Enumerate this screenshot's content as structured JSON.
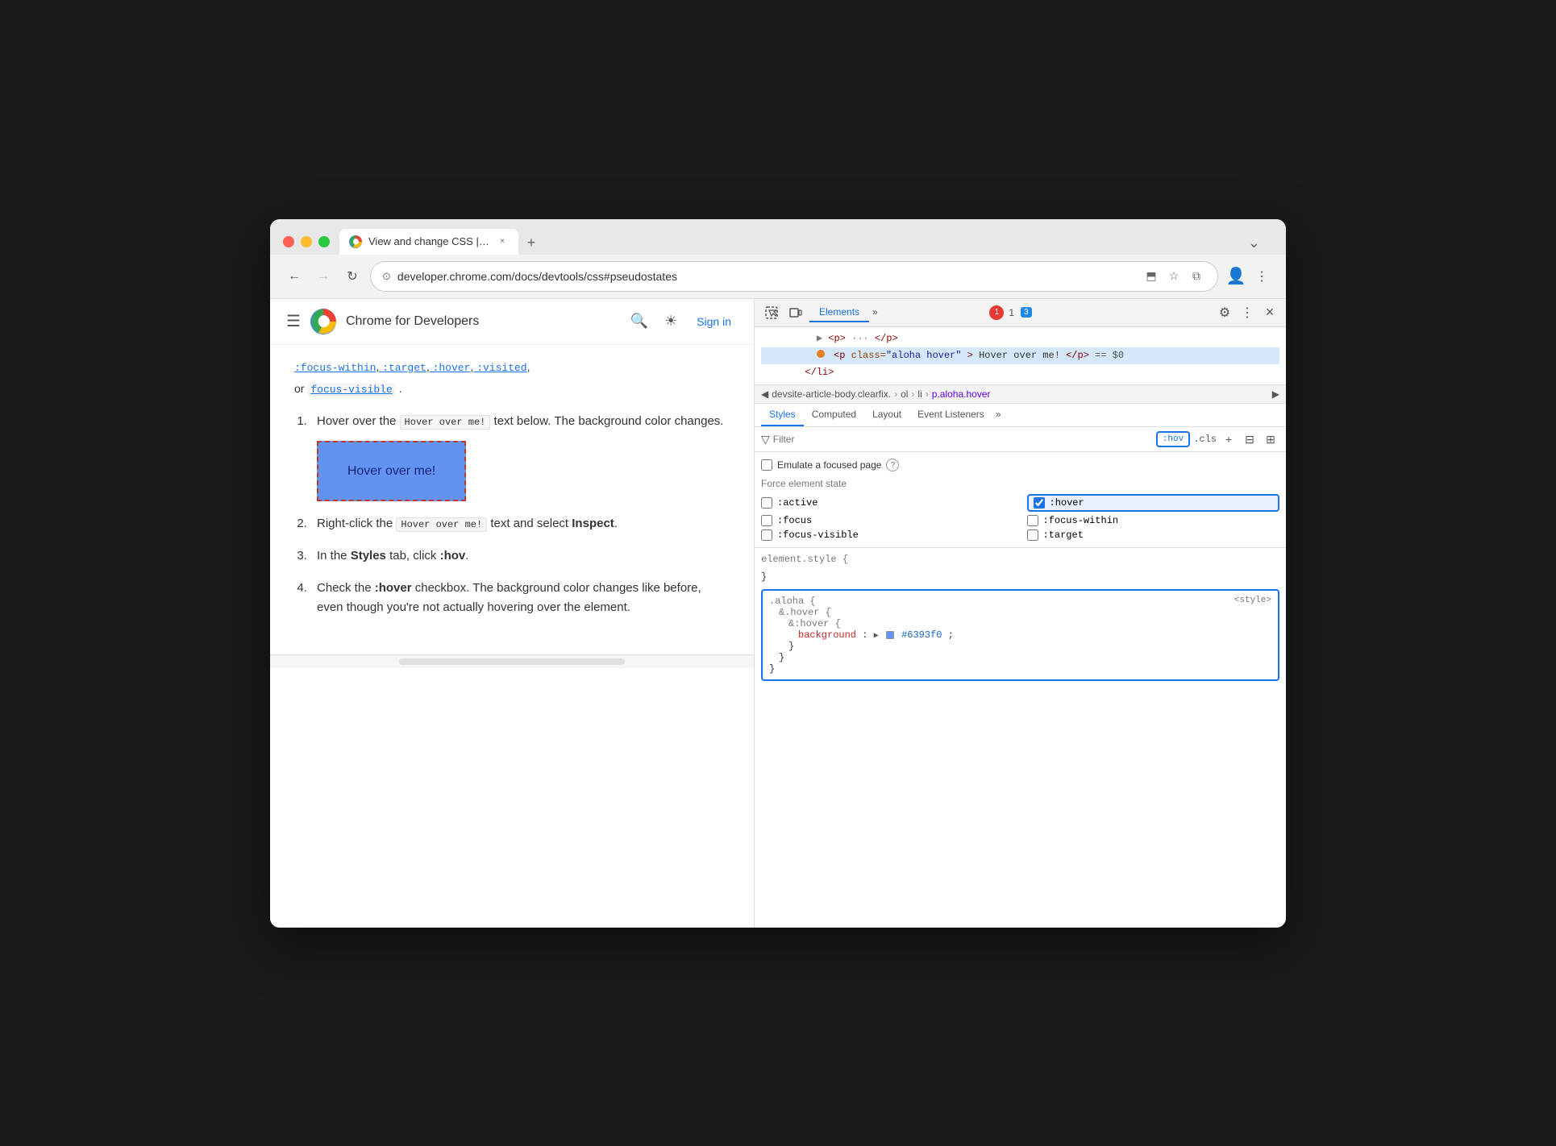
{
  "browser": {
    "traffic_lights": [
      "red",
      "yellow",
      "green"
    ],
    "tab": {
      "title": "View and change CSS | Chr…",
      "close_label": "×"
    },
    "tab_new_label": "+",
    "tab_expand_label": "⌄",
    "nav": {
      "back_label": "←",
      "forward_label": "→",
      "refresh_label": "↻",
      "address": "developer.chrome.com/docs/devtools/css#pseudostates",
      "address_icon": "⊙",
      "cast_label": "⬒",
      "bookmark_label": "☆",
      "extensions_label": "⧉",
      "account_label": "👤",
      "menu_label": "⋮"
    }
  },
  "site_header": {
    "hamburger": "☰",
    "logo_text": "C",
    "name": "Chrome for Developers",
    "search_icon": "🔍",
    "theme_icon": "☀",
    "signin": "Sign in"
  },
  "article": {
    "top_links": ":focus-within, :target, :hover, :visited,",
    "top_text_prefix": "or",
    "focus_visible": "focus-visible",
    "dot": ".",
    "steps": [
      {
        "num": "1",
        "text_before": "Hover over the",
        "code": "Hover over me!",
        "text_after": "text below. The background color changes."
      },
      {
        "num": "2",
        "text_before": "Right-click the",
        "code": "Hover over me!",
        "text_after": "text and select",
        "bold": "Inspect",
        "end": "."
      },
      {
        "num": "3",
        "text_before": "In the",
        "bold_styles": "Styles",
        "text_mid": "tab, click",
        "code2": ":hov",
        "end": "."
      },
      {
        "num": "4",
        "text_before": "Check the",
        "bold": ":hover",
        "text_after": "checkbox. The background color changes like before, even though you're not actually hovering over the element."
      }
    ],
    "hover_box": {
      "text": "Hover over me!"
    }
  },
  "devtools": {
    "toolbar": {
      "cursor_icon": "⊡",
      "device_icon": "▭",
      "elements_tab": "Elements",
      "more_icon": "»",
      "error_count": "1",
      "message_count": "3",
      "settings_icon": "⚙",
      "more_menu_icon": "⋮",
      "close_icon": "×"
    },
    "dom": {
      "line1": "▶ <p> ··· </p>",
      "line2_parts": {
        "open": "<p class=\"",
        "class_name": "aloha hover",
        "close_open": "\">Hover over me!</p>",
        "equals": " == $0"
      },
      "line3": "</li>"
    },
    "breadcrumb": {
      "left_arrow": "◀",
      "items": [
        "devsite-article-body.clearfix.",
        "ol",
        "li"
      ],
      "highlight": "p.aloha.hover",
      "right_arrow": "▶"
    },
    "style_tabs": {
      "tabs": [
        "Styles",
        "Computed",
        "Layout",
        "Event Listeners"
      ],
      "more": ">>"
    },
    "filter": {
      "icon": "▽",
      "placeholder": "Filter",
      "hov": ":hov",
      "cls": ".cls",
      "plus": "+",
      "copy_icon": "⊟",
      "layout_icon": "⊞"
    },
    "force_state": {
      "emulate_label": "Emulate a focused page",
      "info": "?",
      "force_title": "Force element state",
      "states": [
        {
          "label": ":active",
          "checked": false
        },
        {
          "label": ":hover",
          "checked": true
        },
        {
          "label": ":focus",
          "checked": false
        },
        {
          "label": ":focus-within",
          "checked": false
        },
        {
          "label": ":focus-visible",
          "checked": false
        },
        {
          "label": ":target",
          "checked": false
        }
      ]
    },
    "css_rules": {
      "element_style": {
        "selector": "element.style {",
        "close": "}"
      },
      "aloha_rule": {
        "selector1": ".aloha {",
        "selector2": "&.hover {",
        "selector3": "&:hover {",
        "prop": "background",
        "colon": ":",
        "arrow": "▶",
        "color_hex": "#6393f0",
        "close3": "}",
        "close2": "}",
        "close1": "}"
      },
      "source": "<style>"
    }
  }
}
